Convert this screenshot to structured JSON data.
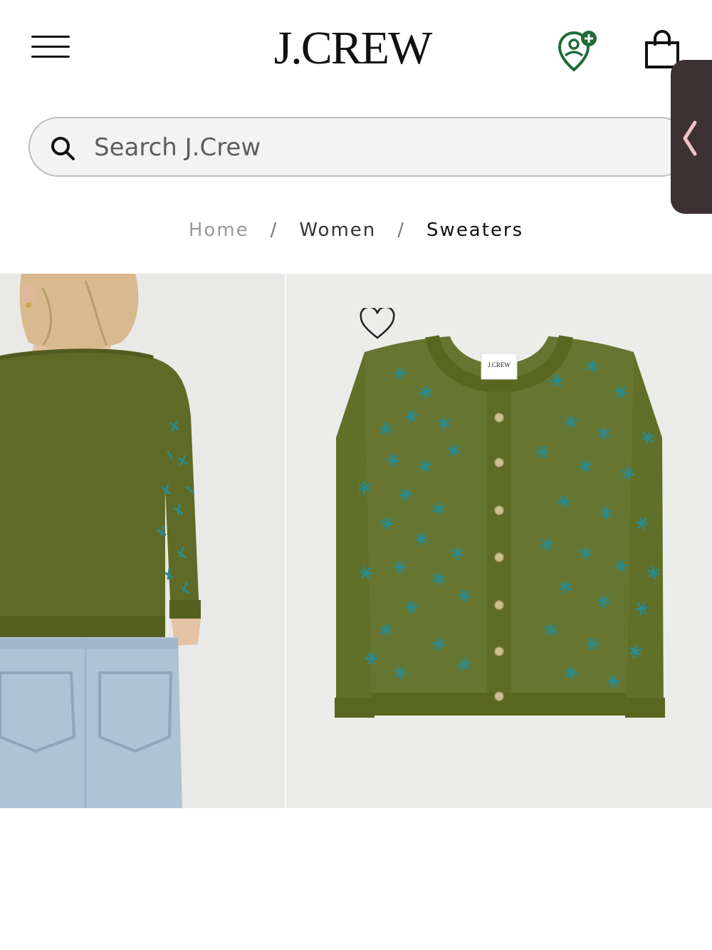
{
  "header": {
    "logo_text": "J.CREW",
    "menu_icon": "hamburger-menu-icon",
    "account_icon": "account-rewards-icon",
    "bag_icon": "shopping-bag-icon"
  },
  "search": {
    "placeholder": "Search J.Crew",
    "value": ""
  },
  "breadcrumb": {
    "items": [
      {
        "label": "Home"
      },
      {
        "label": "Women"
      },
      {
        "label": "Sweaters"
      }
    ],
    "separator": "/"
  },
  "product": {
    "images": [
      {
        "description_icon": "model-back-view-image"
      },
      {
        "description_icon": "cardigan-flat-lay-image"
      }
    ],
    "wishlist_icon": "heart-outline-icon",
    "label_text": "J.CREW"
  },
  "colors": {
    "sweater_olive": "#5f6a26",
    "embroidery_teal": "#2a8a8c",
    "accent_green": "#1f6b3a"
  }
}
